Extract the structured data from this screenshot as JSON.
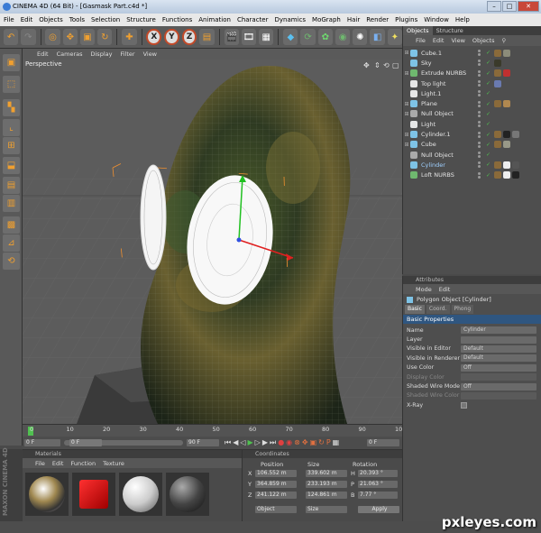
{
  "window": {
    "title": "CINEMA 4D (64 Bit) - [Gasmask Part.c4d *]",
    "buttons": [
      "–",
      "□",
      "✕"
    ]
  },
  "menu": [
    "File",
    "Edit",
    "Objects",
    "Tools",
    "Selection",
    "Structure",
    "Functions",
    "Animation",
    "Character",
    "Dynamics",
    "MoGraph",
    "Hair",
    "Render",
    "Plugins",
    "Window",
    "Help"
  ],
  "viewport": {
    "menu": [
      "Edit",
      "Cameras",
      "Display",
      "Filter",
      "View"
    ],
    "label": "Perspective"
  },
  "toolbar": {
    "axis_x": "X",
    "axis_y": "Y",
    "axis_z": "Z"
  },
  "object_manager": {
    "tabs": [
      "Objects",
      "Structure"
    ],
    "menu": [
      "File",
      "Edit",
      "View",
      "Objects"
    ],
    "items": [
      {
        "name": "Cube.1",
        "icon_color": "#7ec3e6",
        "tags": [
          "#8a6a3a",
          "#8c8c7a"
        ]
      },
      {
        "name": "Sky",
        "icon_color": "#7ec3e6",
        "tags": [
          "#3a3a2a"
        ]
      },
      {
        "name": "Extrude NURBS",
        "icon_color": "#6fb86f",
        "tags": [
          "#8a6a3a",
          "#c03030"
        ]
      },
      {
        "name": "Top light",
        "icon_color": "#e6e6e6",
        "tags": [
          "#6a7ab0"
        ]
      },
      {
        "name": "Light.1",
        "icon_color": "#e6e6e6",
        "tags": []
      },
      {
        "name": "Plane",
        "icon_color": "#7ec3e6",
        "tags": [
          "#8a6a3a",
          "#b08850"
        ]
      },
      {
        "name": "Null Object",
        "icon_color": "#aaaaaa",
        "tags": []
      },
      {
        "name": "Light",
        "icon_color": "#e6e6e6",
        "tags": []
      },
      {
        "name": "Cylinder.1",
        "icon_color": "#7ec3e6",
        "tags": [
          "#8a6a3a",
          "#222222",
          "#777777"
        ]
      },
      {
        "name": "Cube",
        "icon_color": "#7ec3e6",
        "tags": [
          "#8a6a3a",
          "#999988"
        ]
      },
      {
        "name": "Null Object",
        "icon_color": "#aaaaaa",
        "tags": []
      },
      {
        "name": "Cylinder",
        "icon_color": "#7ec3e6",
        "tags": [
          "#8a6a3a",
          "#eeeeee",
          "#555555"
        ],
        "selected": true
      },
      {
        "name": "Loft NURBS",
        "icon_color": "#6fb86f",
        "tags": [
          "#8a6a3a",
          "#eeeeee",
          "#222222"
        ]
      }
    ]
  },
  "attributes": {
    "header": "Attributes",
    "menu": [
      "Mode",
      "Edit"
    ],
    "object": "Polygon Object [Cylinder]",
    "tabs": [
      "Basic",
      "Coord.",
      "Phong"
    ],
    "section": "Basic Properties",
    "fields": [
      {
        "label": "Name",
        "value": "Cylinder",
        "dim": false
      },
      {
        "label": "Layer",
        "value": "",
        "dim": false
      },
      {
        "label": "Visible in Editor",
        "value": "Default",
        "dim": false
      },
      {
        "label": "Visible in Renderer",
        "value": "Default",
        "dim": false
      },
      {
        "label": "Use Color",
        "value": "Off",
        "dim": false
      },
      {
        "label": "Display Color",
        "value": "",
        "dim": true
      },
      {
        "label": "Shaded Wire Mode",
        "value": "Off",
        "dim": false
      },
      {
        "label": "Shaded Wire Color",
        "value": "",
        "dim": true
      },
      {
        "label": "X-Ray",
        "value": "",
        "dim": false
      }
    ]
  },
  "timeline": {
    "ticks": [
      "0",
      "10",
      "20",
      "30",
      "40",
      "50",
      "60",
      "70",
      "80",
      "90",
      "10"
    ],
    "frame": "0 F",
    "current": "0 F",
    "end": "90 F",
    "field_b": "0 F"
  },
  "materials": {
    "header": "Materials",
    "menu": [
      "File",
      "Edit",
      "Function",
      "Texture"
    ],
    "swatches": [
      "chrome",
      "red",
      "white",
      "dark"
    ]
  },
  "coordinates": {
    "header": "Coordinates",
    "cols": [
      "Position",
      "Size",
      "Rotation"
    ],
    "rows": [
      {
        "axis": "X",
        "pos": "106.552 m",
        "size": "339.602 m",
        "rlab": "H",
        "rot": "20.393 °"
      },
      {
        "axis": "Y",
        "pos": "364.859 m",
        "size": "233.193 m",
        "rlab": "P",
        "rot": "21.063 °"
      },
      {
        "axis": "Z",
        "pos": "241.122 m",
        "size": "124.861 m",
        "rlab": "B",
        "rot": "7.77 °"
      }
    ],
    "mode": "Object",
    "size_mode": "Size",
    "apply": "Apply"
  },
  "brand": "MAXON CINEMA 4D",
  "watermark": "pxleyes.com"
}
